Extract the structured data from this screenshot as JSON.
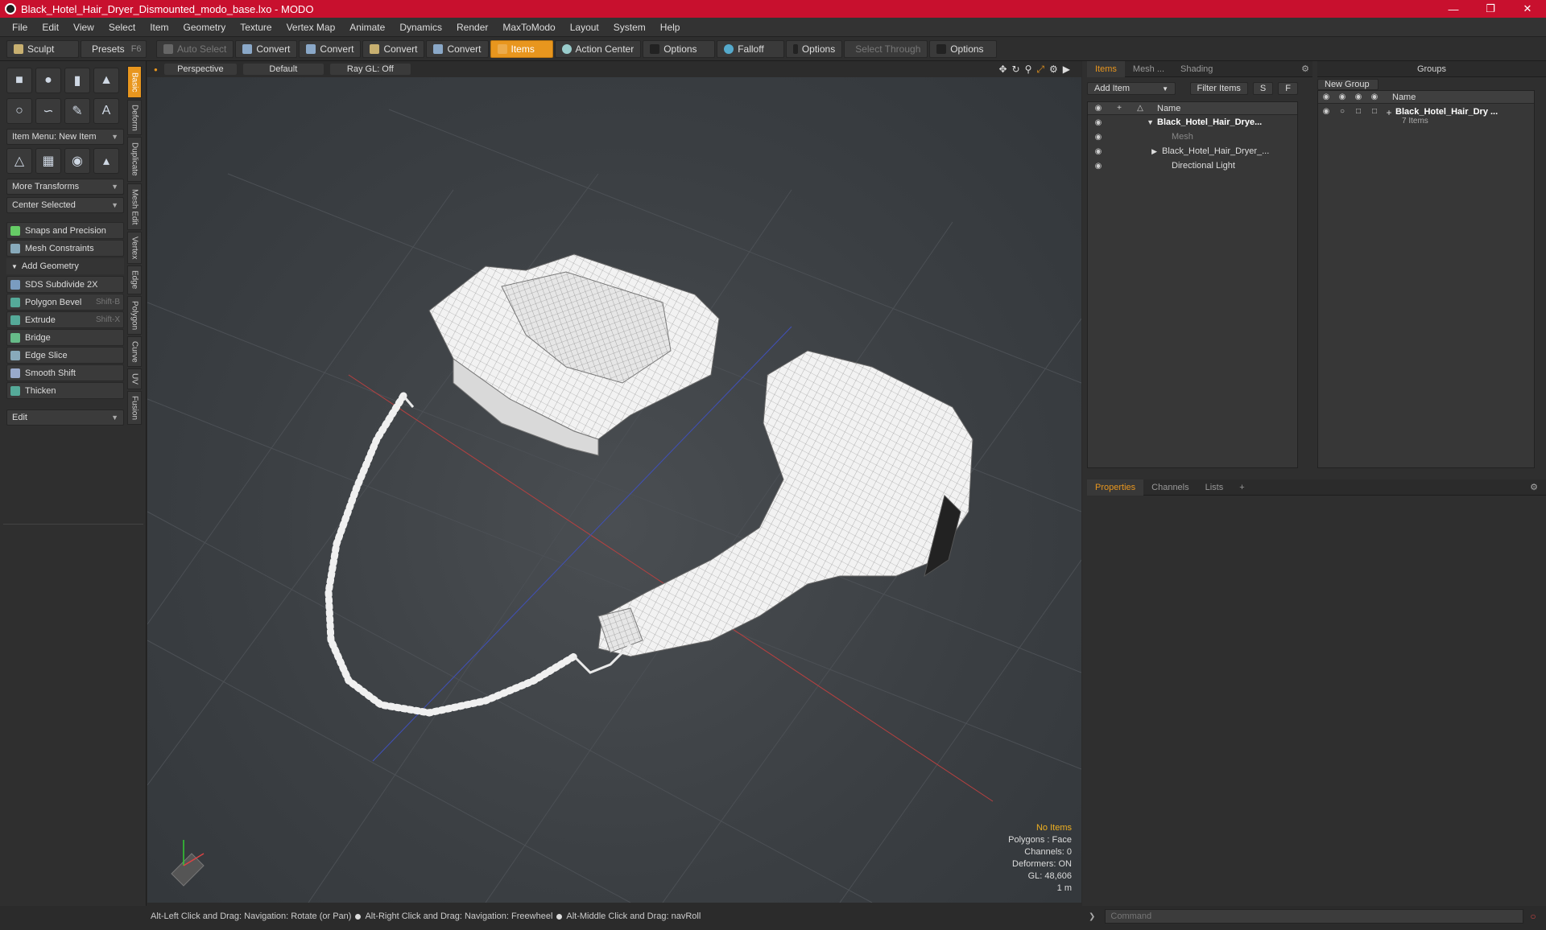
{
  "window": {
    "title": "Black_Hotel_Hair_Dryer_Dismounted_modo_base.lxo - MODO"
  },
  "menu": [
    "File",
    "Edit",
    "View",
    "Select",
    "Item",
    "Geometry",
    "Texture",
    "Vertex Map",
    "Animate",
    "Dynamics",
    "Render",
    "MaxToModo",
    "Layout",
    "System",
    "Help"
  ],
  "toolbar": {
    "sculpt": "Sculpt",
    "presets": "Presets",
    "presets_key": "F6",
    "auto_select": "Auto Select",
    "convert": "Convert",
    "items": "Items",
    "action_center": "Action Center",
    "options": "Options",
    "falloff": "Falloff",
    "select_through": "Select Through"
  },
  "left": {
    "item_menu": "Item Menu: New Item",
    "more_transforms": "More Transforms",
    "center_selected": "Center Selected",
    "snaps": "Snaps and Precision",
    "mesh_constraints": "Mesh Constraints",
    "add_geometry": "Add Geometry",
    "tools": [
      {
        "label": "SDS Subdivide 2X",
        "key": ""
      },
      {
        "label": "Polygon Bevel",
        "key": "Shift-B"
      },
      {
        "label": "Extrude",
        "key": "Shift-X"
      },
      {
        "label": "Bridge",
        "key": ""
      },
      {
        "label": "Edge Slice",
        "key": ""
      },
      {
        "label": "Smooth Shift",
        "key": ""
      },
      {
        "label": "Thicken",
        "key": ""
      }
    ],
    "edit": "Edit",
    "vtabs": [
      "Basic",
      "Deform",
      "Duplicate",
      "Mesh Edit",
      "Vertex",
      "Edge",
      "Polygon",
      "Curve",
      "UV",
      "Fusion"
    ]
  },
  "viewport": {
    "perspective": "Perspective",
    "default": "Default",
    "raygl": "Ray GL: Off",
    "info": {
      "no_items": "No Items",
      "polygons": "Polygons : Face",
      "channels": "Channels: 0",
      "deformers": "Deformers: ON",
      "gl": "GL: 48,606",
      "scale": "1 m"
    }
  },
  "status": {
    "s1": "Alt-Left Click and Drag: Navigation: Rotate (or Pan)",
    "s2": "Alt-Right Click and Drag: Navigation: Freewheel",
    "s3": "Alt-Middle Click and Drag: navRoll"
  },
  "items_panel": {
    "tabs": [
      "Items",
      "Mesh ...",
      "Shading"
    ],
    "add_item": "Add Item",
    "filter_items": "Filter Items",
    "s": "S",
    "f": "F",
    "name_col": "Name",
    "rows": [
      "Black_Hotel_Hair_Drye...",
      "Mesh",
      "Black_Hotel_Hair_Dryer_...",
      "Directional Light"
    ]
  },
  "groups_panel": {
    "title": "Groups",
    "new_group": "New Group",
    "name_col": "Name",
    "group_name": "Black_Hotel_Hair_Dry ...",
    "group_count": "7 Items"
  },
  "props_panel": {
    "tabs": [
      "Properties",
      "Channels",
      "Lists"
    ],
    "plus": "+"
  },
  "command": {
    "placeholder": "Command"
  }
}
